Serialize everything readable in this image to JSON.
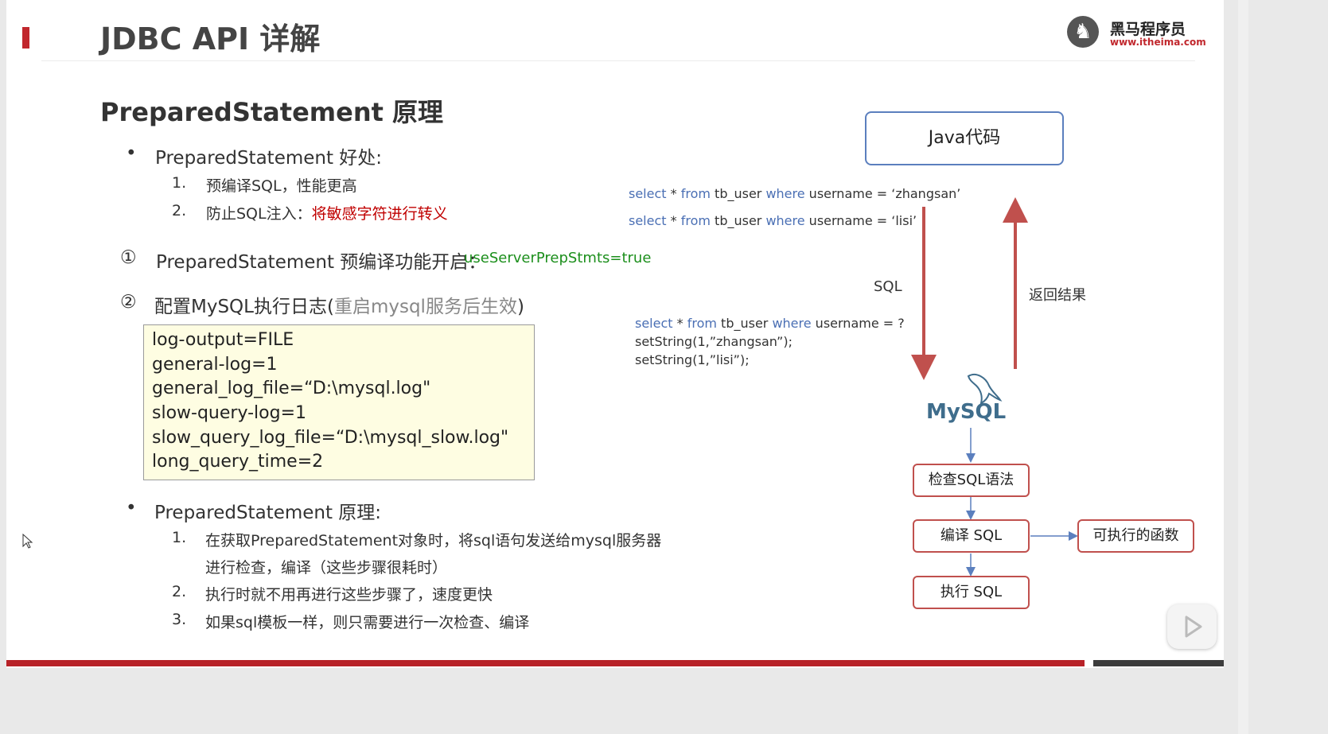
{
  "slide": {
    "title": "JDBC API 详解",
    "logo": {
      "name_cn": "黑马程序员",
      "url": "www.itheima.com",
      "icon": "horse-logo-icon"
    },
    "subtitle": "PreparedStatement 原理",
    "benefits": {
      "heading": "PreparedStatement 好处:",
      "items": [
        {
          "num": "1.",
          "text": "预编译SQL，性能更高",
          "highlight": ""
        },
        {
          "num": "2.",
          "text": "防止SQL注入：",
          "highlight": "将敏感字符进行转义"
        }
      ]
    },
    "step1": {
      "marker": "①",
      "text": "PreparedStatement 预编译功能开启：",
      "code": "useServerPrepStmts=true"
    },
    "step2": {
      "marker": "②",
      "text": "配置MySQL执行日志(",
      "note": "重启mysql服务后生效",
      "close": ")"
    },
    "config_lines": [
      "log-output=FILE",
      "general-log=1",
      "general_log_file=“D:\\mysql.log\"",
      "slow-query-log=1",
      "slow_query_log_file=“D:\\mysql_slow.log\"",
      "long_query_time=2"
    ],
    "principle": {
      "heading": "PreparedStatement 原理:",
      "items": [
        {
          "num": "1.",
          "text": "在获取PreparedStatement对象时，将sql语句发送给mysql服务器"
        },
        {
          "num": "",
          "text": "进行检查，编译（这些步骤很耗时）"
        },
        {
          "num": "2.",
          "text": "执行时就不用再进行这些步骤了，速度更快"
        },
        {
          "num": "3.",
          "text": "如果sql模板一样，则只需要进行一次检查、编译"
        }
      ]
    }
  },
  "diagram": {
    "java_box": "Java代码",
    "sql_lines": [
      {
        "kw1": "select",
        "mid1": " * ",
        "kw2": "from",
        "mid2": " tb_user ",
        "kw3": "where",
        "rest": " username = ‘zhangsan’"
      },
      {
        "kw1": "select",
        "mid1": " * ",
        "kw2": "from",
        "mid2": " tb_user ",
        "kw3": "where",
        "rest": " username = ‘lisi’"
      }
    ],
    "prepared": {
      "kw1": "select",
      "mid1": " * ",
      "kw2": "from",
      "mid2": " tb_user ",
      "kw3": "where",
      "rest": " username = ?",
      "set1": "setString(1,”zhangsan”);",
      "set2": "setString(1,”lisi”);"
    },
    "arrow_down_label": "SQL",
    "arrow_up_label": "返回结果",
    "mysql_logo": "MySQL",
    "check_box": "检查SQL语法",
    "compile_box": "编译 SQL",
    "execute_box": "执行 SQL",
    "function_box": "可执行的函数"
  },
  "colors": {
    "accent_red": "#c1272d",
    "keyword_blue": "#4a6fb4",
    "box_blue": "#5b7fbe",
    "box_red": "#c0504d",
    "highlight_red": "#c00000",
    "code_green": "#1c8f1c"
  }
}
